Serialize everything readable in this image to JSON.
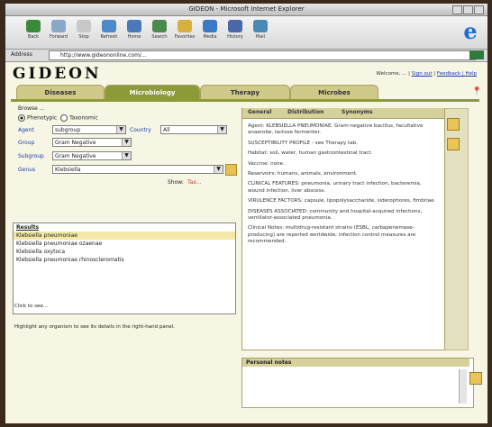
{
  "window": {
    "title": "GIDEON - Microsoft Internet Explorer"
  },
  "toolbar": {
    "buttons": [
      {
        "label": "Back",
        "icon": "back-arrow-icon",
        "color": "#3a8a3a"
      },
      {
        "label": "Forward",
        "icon": "forward-arrow-icon",
        "color": "#8aa8c8"
      },
      {
        "label": "Stop",
        "icon": "stop-icon",
        "color": "#c8c8c8"
      },
      {
        "label": "Refresh",
        "icon": "refresh-icon",
        "color": "#4a8ac8"
      },
      {
        "label": "Home",
        "icon": "home-icon",
        "color": "#4a78b8"
      },
      {
        "label": "Search",
        "icon": "search-icon",
        "color": "#4a8a4a"
      },
      {
        "label": "Favorites",
        "icon": "favorites-icon",
        "color": "#d8b040"
      },
      {
        "label": "Media",
        "icon": "media-icon",
        "color": "#3a78c8"
      },
      {
        "label": "History",
        "icon": "history-icon",
        "color": "#4a68a8"
      },
      {
        "label": "Mail",
        "icon": "mail-icon",
        "color": "#4a88b8"
      }
    ]
  },
  "address": {
    "label": "Address",
    "url": "http://www.gideononline.com/..."
  },
  "brand": {
    "logo": "GIDEON"
  },
  "top_links": {
    "welcome": "Welcome, ... | ",
    "sign_out": "Sign out",
    "links": "Feedback | Help"
  },
  "tabs": [
    "Diseases",
    "Microbiology",
    "Therapy",
    "Microbes"
  ],
  "active_tab": 1,
  "left": {
    "section_label": "Browse ...",
    "radio_a": "Phenotypic",
    "radio_b": "Taxonomic",
    "row1_label": "Agent",
    "row1_value": "subgroup",
    "row1_label2": "Country",
    "row1_value2": "All",
    "row2_label": "Group",
    "row2_value": "Gram Negative",
    "row3_label": "Subgroup",
    "row3_value": "Gram Negative",
    "row4_label": "Genus",
    "row4_value": "Klebsiella",
    "show_label": "Show:",
    "show_value": "Tax...",
    "list_header": "Results",
    "list_items": [
      "Klebsiella pneumoniae",
      "Klebsiella pneumoniae ozaenae",
      "Klebsiella oxytoca",
      "Klebsiella pneumoniae rhinoscleromatis"
    ],
    "footer1": "Click to see...",
    "footer2": "Highlight any organism to see its details in the right-hand panel."
  },
  "right": {
    "tabs": [
      "General",
      "Distribution",
      "Synonyms"
    ],
    "paragraphs": [
      "Agent: KLEBSIELLA PNEUMONIAE. Gram-negative bacillus, facultative anaerobe, lactose fermenter.",
      "SUSCEPTIBILITY PROFILE - see Therapy tab.",
      "Habitat: soil, water, human gastrointestinal tract.",
      "Vaccine: none.",
      "Reservoirs: humans, animals, environment.",
      "CLINICAL FEATURES: pneumonia, urinary tract infection, bacteremia, wound infection, liver abscess.",
      "VIRULENCE FACTORS: capsule, lipopolysaccharide, siderophores, fimbriae.",
      "DISEASES ASSOCIATED: community and hospital-acquired infections, ventilator-associated pneumonia.",
      "Clinical Notes: multidrug-resistant strains (ESBL, carbapenemase-producing) are reported worldwide; infection control measures are recommended."
    ],
    "notes_header": "Personal notes"
  },
  "colors": {
    "accent": "#8c9a38",
    "tab": "#cfc98a",
    "panel": "#f7f5e4"
  }
}
